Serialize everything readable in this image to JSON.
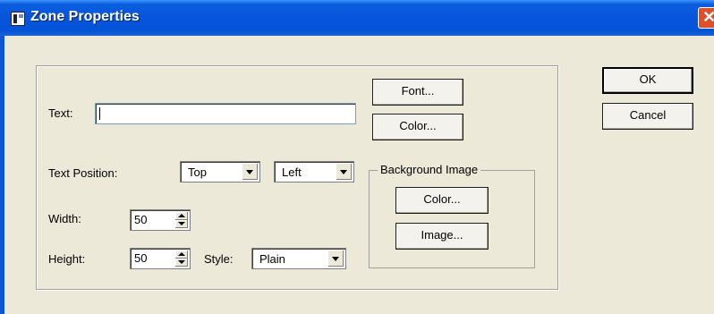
{
  "window": {
    "title": "Zone Properties",
    "close_glyph": "✕"
  },
  "form": {
    "text_label": "Text:",
    "text_value": "",
    "text_position_label": "Text Position:",
    "vertical_position": "Top",
    "horizontal_position": "Left",
    "width_label": "Width:",
    "width_value": "50",
    "height_label": "Height:",
    "height_value": "50",
    "style_label": "Style:",
    "style_value": "Plain"
  },
  "buttons": {
    "font": "Font...",
    "color": "Color...",
    "ok": "OK",
    "cancel": "Cancel"
  },
  "background_image": {
    "group_label": "Background Image",
    "color_button": "Color...",
    "image_button": "Image..."
  },
  "icons": {
    "app": "zone-properties-app-icon",
    "close": "close-icon",
    "dropdown": "chevron-down-icon",
    "spin_up": "spin-up-icon",
    "spin_down": "spin-down-icon"
  },
  "colors": {
    "titlebar": "#0a5fde",
    "close": "#e04e2a",
    "dialog_bg": "#ece9d8"
  }
}
